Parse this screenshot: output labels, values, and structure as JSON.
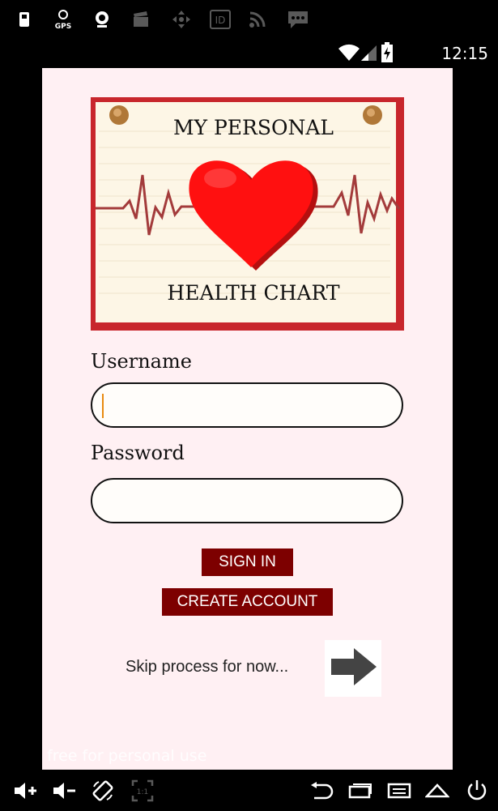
{
  "status_bar": {
    "time": "12:15",
    "notification_icons": [
      "sim-card-icon",
      "gps-icon",
      "webcam-icon",
      "clapper-icon",
      "dpad-icon",
      "id-icon",
      "rss-icon",
      "message-icon"
    ],
    "status_icons": [
      "wifi-icon",
      "signal-icon",
      "battery-charging-icon"
    ],
    "gps_label": "GPS",
    "id_label": "ID"
  },
  "logo": {
    "line1": "MY PERSONAL",
    "line2": "HEALTH CHART"
  },
  "login_form": {
    "username_label": "Username",
    "username_value": "",
    "password_label": "Password",
    "password_value": ""
  },
  "buttons": {
    "sign_in": "SIGN IN",
    "create_account": "CREATE ACCOUNT"
  },
  "skip": {
    "text": "Skip process for now...",
    "icon": "arrow-right-icon"
  },
  "watermark": "free for personal use",
  "nav_bar": {
    "icons": [
      "volume-up-icon",
      "volume-down-icon",
      "rotate-icon",
      "scale-1to1-icon",
      "back-icon",
      "home-icon",
      "menu-icon",
      "recents-icon",
      "power-icon"
    ],
    "scale_label": "1:1"
  },
  "colors": {
    "screen_bg": "#fff0f3",
    "button_bg": "#7d0000",
    "heart": "#ff1010"
  }
}
